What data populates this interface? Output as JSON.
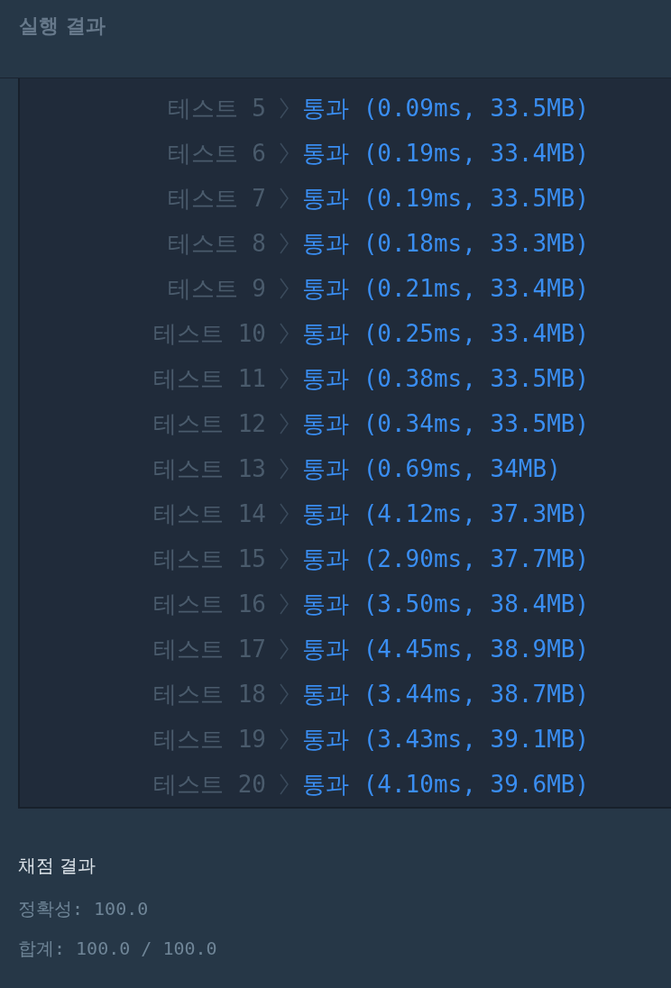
{
  "run_results": {
    "title": "실행 결과",
    "tests": [
      {
        "label": "테스트 5",
        "kind": "pass",
        "result": "통과 (0.09ms, 33.5MB)"
      },
      {
        "label": "테스트 6",
        "kind": "pass",
        "result": "통과 (0.19ms, 33.4MB)"
      },
      {
        "label": "테스트 7",
        "kind": "pass",
        "result": "통과 (0.19ms, 33.5MB)"
      },
      {
        "label": "테스트 8",
        "kind": "pass",
        "result": "통과 (0.18ms, 33.3MB)"
      },
      {
        "label": "테스트 9",
        "kind": "pass",
        "result": "통과 (0.21ms, 33.4MB)"
      },
      {
        "label": "테스트 10",
        "kind": "pass",
        "result": "통과 (0.25ms, 33.4MB)"
      },
      {
        "label": "테스트 11",
        "kind": "pass",
        "result": "통과 (0.38ms, 33.5MB)"
      },
      {
        "label": "테스트 12",
        "kind": "pass",
        "result": "통과 (0.34ms, 33.5MB)"
      },
      {
        "label": "테스트 13",
        "kind": "pass",
        "result": "통과 (0.69ms, 34MB)"
      },
      {
        "label": "테스트 14",
        "kind": "pass",
        "result": "통과 (4.12ms, 37.3MB)"
      },
      {
        "label": "테스트 15",
        "kind": "pass",
        "result": "통과 (2.90ms, 37.7MB)"
      },
      {
        "label": "테스트 16",
        "kind": "pass",
        "result": "통과 (3.50ms, 38.4MB)"
      },
      {
        "label": "테스트 17",
        "kind": "pass",
        "result": "통과 (4.45ms, 38.9MB)"
      },
      {
        "label": "테스트 18",
        "kind": "pass",
        "result": "통과 (3.44ms, 38.7MB)"
      },
      {
        "label": "테스트 19",
        "kind": "pass",
        "result": "통과 (3.43ms, 39.1MB)"
      },
      {
        "label": "테스트 20",
        "kind": "pass",
        "result": "통과 (4.10ms, 39.6MB)"
      }
    ]
  },
  "grading": {
    "title": "채점 결과",
    "lines": [
      "정확성: 100.0",
      "합계: 100.0 / 100.0"
    ]
  }
}
